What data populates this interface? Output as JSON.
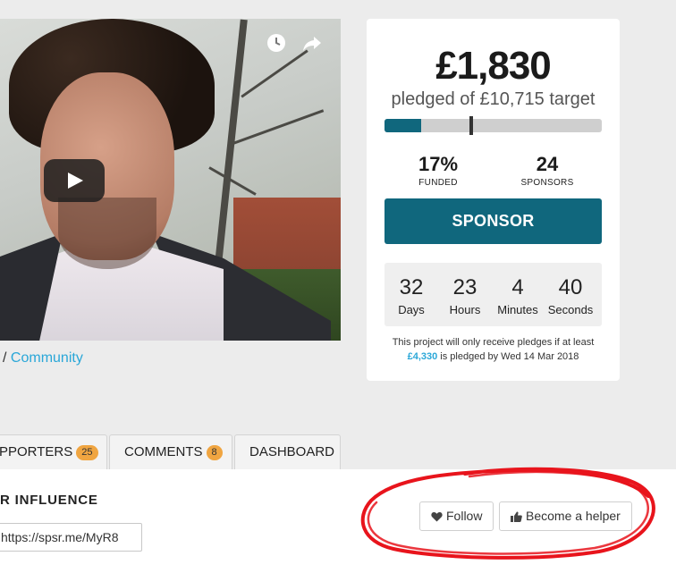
{
  "video": {
    "icons": {
      "clock": "clock-icon",
      "share": "share-arrow-icon",
      "play": "play-icon"
    }
  },
  "breadcrumb": {
    "separator": "/",
    "link": "Community"
  },
  "funding": {
    "amount": "£1,830",
    "target_text": "pledged of £10,715 target",
    "progress_percent": 17,
    "minimum_marker_percent": 40,
    "funded_value": "17%",
    "funded_label": "FUNDED",
    "sponsors_value": "24",
    "sponsors_label": "SPONSORS",
    "sponsor_button": "SPONSOR",
    "countdown": [
      {
        "value": "32",
        "label": "Days"
      },
      {
        "value": "23",
        "label": "Hours"
      },
      {
        "value": "4",
        "label": "Minutes"
      },
      {
        "value": "40",
        "label": "Seconds"
      }
    ],
    "note_prefix": "This project will only receive pledges if at least",
    "note_amount": "£4,330",
    "note_suffix": "is pledged by Wed 14 Mar 2018"
  },
  "tabs": [
    {
      "label": "PPORTERS",
      "badge": "25"
    },
    {
      "label": "COMMENTS",
      "badge": "8"
    },
    {
      "label": "DASHBOARD"
    }
  ],
  "influence": {
    "heading": "R INFLUENCE",
    "link_value": "https://spsr.me/MyR8"
  },
  "actions": {
    "follow": "Follow",
    "helper": "Become a helper"
  },
  "colors": {
    "accent": "#10677d",
    "link": "#2aa7d8",
    "badge": "#f0a541",
    "annotation": "#e8141c"
  }
}
